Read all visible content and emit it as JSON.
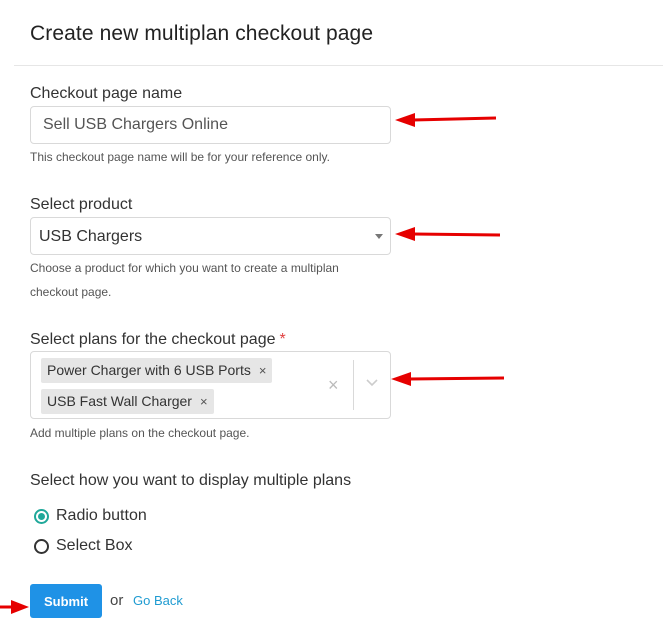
{
  "page": {
    "title": "Create new multiplan checkout page"
  },
  "checkout_name": {
    "label": "Checkout page name",
    "value": "Sell USB Chargers Online",
    "help": "This checkout page name will be for your reference only."
  },
  "product": {
    "label": "Select product",
    "selected": "USB Chargers",
    "help": "Choose a product for which you want to create a multiplan checkout page."
  },
  "plans": {
    "label": "Select plans for the checkout page",
    "required_mark": "*",
    "selected": [
      {
        "label": "Power Charger with 6 USB Ports",
        "remove": "×"
      },
      {
        "label": "USB Fast Wall Charger",
        "remove": "×"
      }
    ],
    "clear": "×",
    "help": "Add multiple plans on the checkout page."
  },
  "display": {
    "label": "Select how you want to display multiple plans",
    "options": [
      {
        "label": "Radio button",
        "checked": true
      },
      {
        "label": "Select Box",
        "checked": false
      }
    ]
  },
  "actions": {
    "submit": "Submit",
    "or": "or",
    "back": "Go Back"
  },
  "colors": {
    "accent": "#1f92e6",
    "radio_checked": "#20a89a",
    "annotation_arrow": "#e60000"
  },
  "icons": {
    "select_caret": "caret-down-icon",
    "multi_dropdown": "chevron-down-icon",
    "annotation": "red-arrow-icon"
  }
}
